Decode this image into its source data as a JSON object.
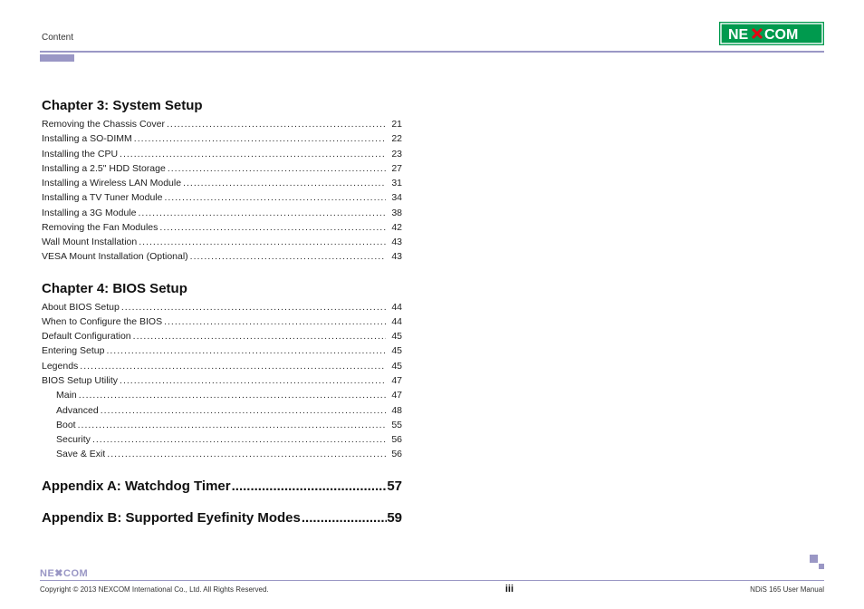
{
  "header": {
    "label": "Content",
    "logo_text_1": "NE",
    "logo_text_2": "COM"
  },
  "chapters": {
    "ch3": {
      "title": "Chapter 3: System Setup",
      "items": [
        {
          "label": "Removing the Chassis Cover",
          "page": "21",
          "sub": false
        },
        {
          "label": "Installing a SO-DIMM",
          "page": "22",
          "sub": false
        },
        {
          "label": "Installing the CPU",
          "page": "23",
          "sub": false
        },
        {
          "label": "Installing a 2.5\" HDD Storage",
          "page": "27",
          "sub": false
        },
        {
          "label": "Installing a Wireless LAN Module",
          "page": "31",
          "sub": false
        },
        {
          "label": "Installing a TV Tuner Module",
          "page": "34",
          "sub": false
        },
        {
          "label": "Installing a 3G Module",
          "page": "38",
          "sub": false
        },
        {
          "label": "Removing the Fan Modules",
          "page": "42",
          "sub": false
        },
        {
          "label": "Wall Mount Installation",
          "page": "43",
          "sub": false
        },
        {
          "label": "VESA Mount Installation (Optional)",
          "page": "43",
          "sub": false
        }
      ]
    },
    "ch4": {
      "title": "Chapter 4: BIOS Setup",
      "items": [
        {
          "label": "About BIOS Setup",
          "page": "44",
          "sub": false
        },
        {
          "label": "When to Configure the BIOS",
          "page": "44",
          "sub": false
        },
        {
          "label": "Default Configuration",
          "page": "45",
          "sub": false
        },
        {
          "label": "Entering Setup",
          "page": "45",
          "sub": false
        },
        {
          "label": "Legends",
          "page": "45",
          "sub": false
        },
        {
          "label": "BIOS Setup Utility",
          "page": "47",
          "sub": false
        },
        {
          "label": "Main",
          "page": "47",
          "sub": true
        },
        {
          "label": "Advanced",
          "page": "48",
          "sub": true
        },
        {
          "label": "Boot",
          "page": "55",
          "sub": true
        },
        {
          "label": "Security",
          "page": "56",
          "sub": true
        },
        {
          "label": "Save & Exit",
          "page": "56",
          "sub": true
        }
      ]
    },
    "appA": {
      "label": "Appendix A: Watchdog Timer",
      "page": "57"
    },
    "appB": {
      "label": "Appendix B: Supported Eyefinity Modes",
      "page": "59"
    }
  },
  "footer": {
    "logo": "NE✖COM",
    "copyright": "Copyright © 2013 NEXCOM International Co., Ltd. All Rights Reserved.",
    "page_num": "iii",
    "manual": "NDiS 165 User Manual"
  }
}
